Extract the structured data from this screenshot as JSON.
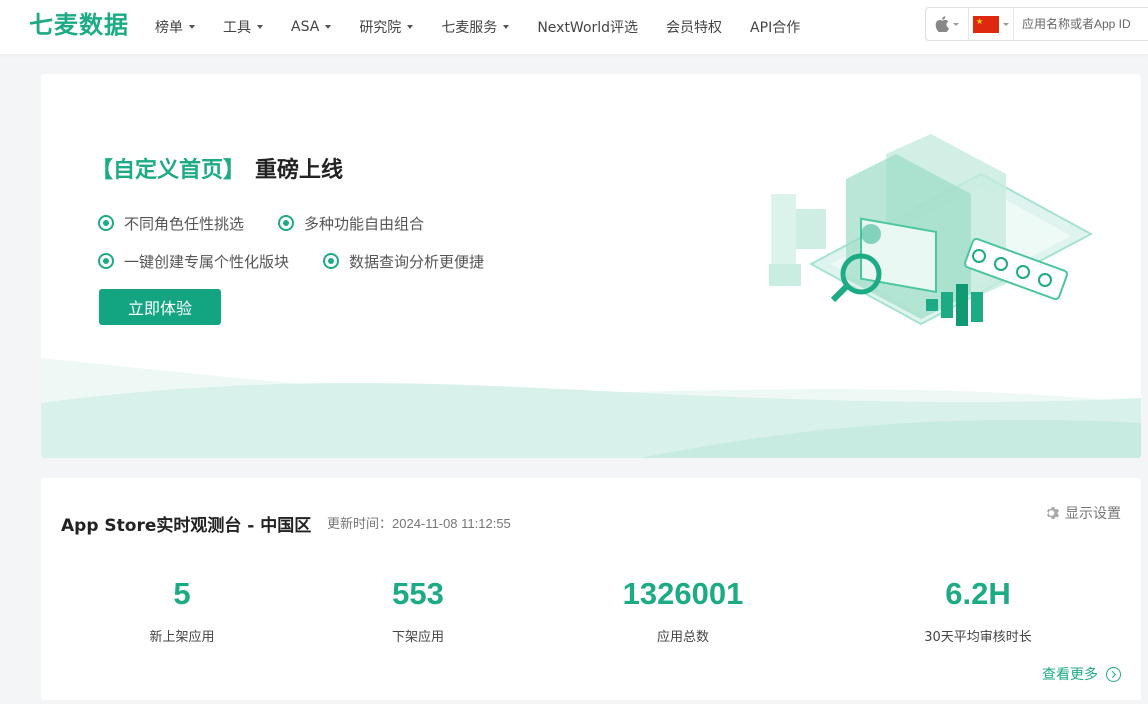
{
  "header": {
    "logo": "七麦数据",
    "nav": [
      {
        "label": "榜单",
        "dropdown": true
      },
      {
        "label": "工具",
        "dropdown": true
      },
      {
        "label": "ASA",
        "dropdown": true
      },
      {
        "label": "研究院",
        "dropdown": true
      },
      {
        "label": "七麦服务",
        "dropdown": true
      },
      {
        "label": "NextWorld评选",
        "dropdown": false
      },
      {
        "label": "会员特权",
        "dropdown": false
      },
      {
        "label": "API合作",
        "dropdown": false
      }
    ],
    "search": {
      "platform_icon": "apple-icon",
      "region_icon": "china-flag-icon",
      "placeholder": "应用名称或者App ID"
    }
  },
  "banner": {
    "title_bracket": "【自定义首页】",
    "title_sub": "重磅上线",
    "features": [
      [
        "不同角色任性挑选",
        "多种功能自由组合"
      ],
      [
        "一键创建专属个性化版块",
        "数据查询分析更便捷"
      ]
    ],
    "button": "立即体验"
  },
  "panel": {
    "title": "App Store实时观测台 - 中国区",
    "update_time": "更新时间：2024-11-08 11:12:55",
    "settings_label": "显示设置",
    "stats": [
      {
        "value": "5",
        "label": "新上架应用"
      },
      {
        "value": "553",
        "label": "下架应用"
      },
      {
        "value": "1326001",
        "label": "应用总数"
      },
      {
        "value": "6.2H",
        "label": "30天平均审核时长"
      }
    ],
    "more_label": "查看更多"
  },
  "colors": {
    "accent": "#1dab85",
    "button": "#13a581"
  }
}
